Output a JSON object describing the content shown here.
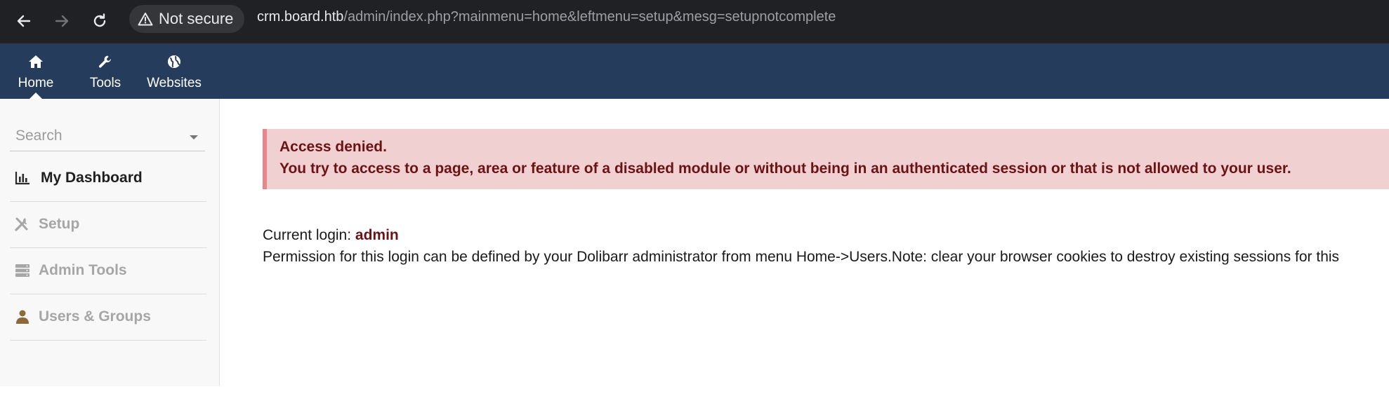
{
  "browser": {
    "security_label": "Not secure",
    "url_host": "crm.board.htb",
    "url_path": "/admin/index.php?mainmenu=home&leftmenu=setup&mesg=setupnotcomplete"
  },
  "topmenu": {
    "items": [
      {
        "label": "Home",
        "icon": "home-icon",
        "active": true
      },
      {
        "label": "Tools",
        "icon": "wrench-icon"
      },
      {
        "label": "Websites",
        "icon": "globe-icon"
      }
    ]
  },
  "sidebar": {
    "search_placeholder": "Search",
    "items": [
      {
        "label": "My Dashboard",
        "icon": "chart-icon",
        "current": true
      },
      {
        "label": "Setup",
        "icon": "tools-icon"
      },
      {
        "label": "Admin Tools",
        "icon": "server-icon"
      },
      {
        "label": "Users & Groups",
        "icon": "user-icon"
      }
    ]
  },
  "main": {
    "alert_title": "Access denied.",
    "alert_message": "You try to access to a page, area or feature of a disabled module or without being in an authenticated session or that is not allowed to your user.",
    "login_label": "Current login: ",
    "login_user": "admin",
    "permission_text": "Permission for this login can be defined by your Dolibarr administrator from menu Home->Users.Note: clear your browser cookies to destroy existing sessions for this"
  },
  "colors": {
    "chrome_bg": "#202124",
    "topmenu_bg": "#263c5c",
    "alert_bg": "#f1d0d2",
    "alert_text": "#6d1214"
  }
}
